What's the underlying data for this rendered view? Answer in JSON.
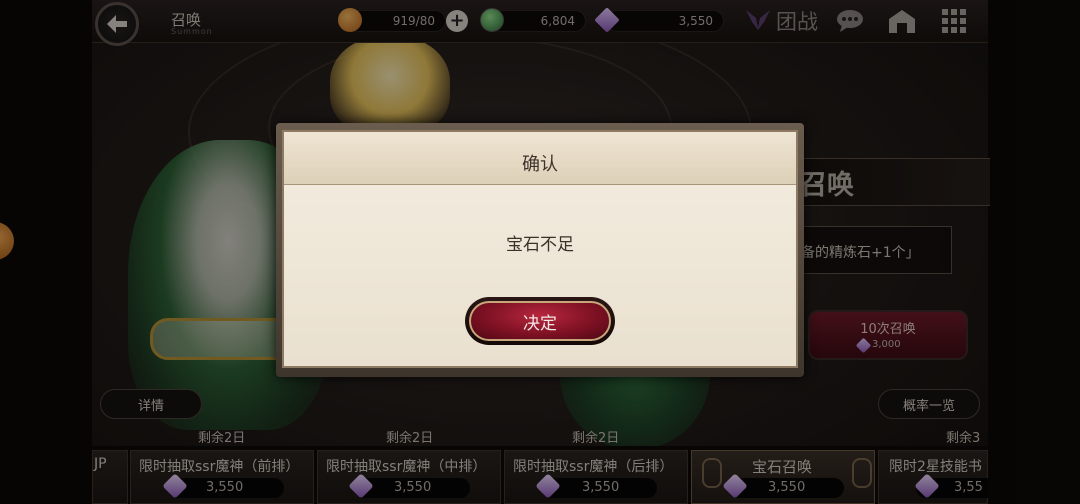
{
  "header": {
    "title": "召唤",
    "subtitle": "Summon",
    "stamina": "919/80",
    "potions": "6,804",
    "gems": "3,550",
    "team_label": "团战"
  },
  "right_panel": {
    "banner_title": "召唤",
    "banner_desc": "备的精炼石+1个」",
    "ten_summon_label": "10次召唤",
    "ten_summon_cost": "3,000",
    "odds_button": "概率一览"
  },
  "details_button": "详情",
  "tabs": [
    {
      "remaining": "",
      "label": "JP",
      "cost": ""
    },
    {
      "remaining": "剩余2日",
      "label": "限时抽取ssr魔神（前排）",
      "cost": "3,550"
    },
    {
      "remaining": "剩余2日",
      "label": "限时抽取ssr魔神（中排）",
      "cost": "3,550"
    },
    {
      "remaining": "剩余2日",
      "label": "限时抽取ssr魔神（后排）",
      "cost": "3,550"
    },
    {
      "remaining": "",
      "label": "宝石召唤",
      "cost": "3,550"
    },
    {
      "remaining": "剩余3",
      "label": "限时2星技能书",
      "cost": "3,55"
    }
  ],
  "dialog": {
    "title": "确认",
    "message": "宝石不足",
    "confirm_label": "决定"
  },
  "colors": {
    "accent_red": "#8c1528",
    "dialog_bg": "#efe6d6",
    "gold_border": "#c7a47a"
  },
  "icons": [
    "back-arrow-icon",
    "bread-icon",
    "plus-icon",
    "potion-icon",
    "gem-icon",
    "team-wing-icon",
    "chat-icon",
    "home-icon",
    "grid-menu-icon"
  ]
}
